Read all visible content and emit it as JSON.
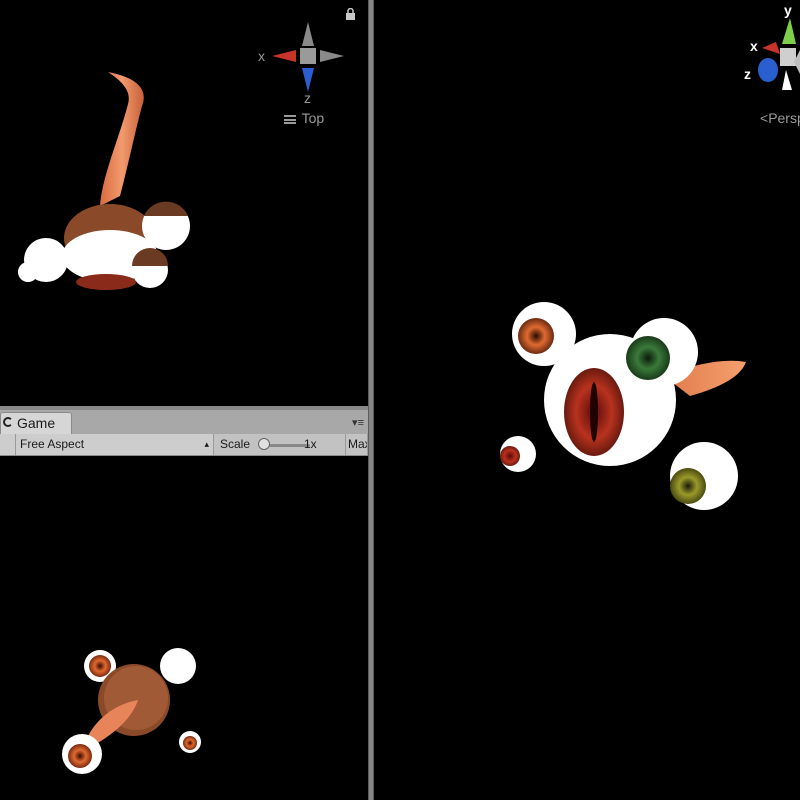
{
  "scene_top": {
    "gizmo_axes": {
      "x": "x",
      "z": "z"
    },
    "view_label": "Top",
    "menu_icon": "hamburger-icon",
    "lock_icon": "lock-icon"
  },
  "scene_persp": {
    "gizmo_axes": {
      "x": "x",
      "y": "y",
      "z": "z"
    },
    "view_label": "Persp"
  },
  "game": {
    "tab_label": "Game",
    "aspect": "Free Aspect",
    "scale_label": "Scale",
    "scale_value": "1x",
    "maximize_label": "Maximize On Play"
  },
  "colors": {
    "axis_x": "#c8342a",
    "axis_y": "#7ed04a",
    "axis_z": "#2a5fd0",
    "tentacle": "#e8845a",
    "iris_red": "#b8321e",
    "iris_green": "#3a7a3a",
    "iris_olive": "#9a9a2a"
  }
}
